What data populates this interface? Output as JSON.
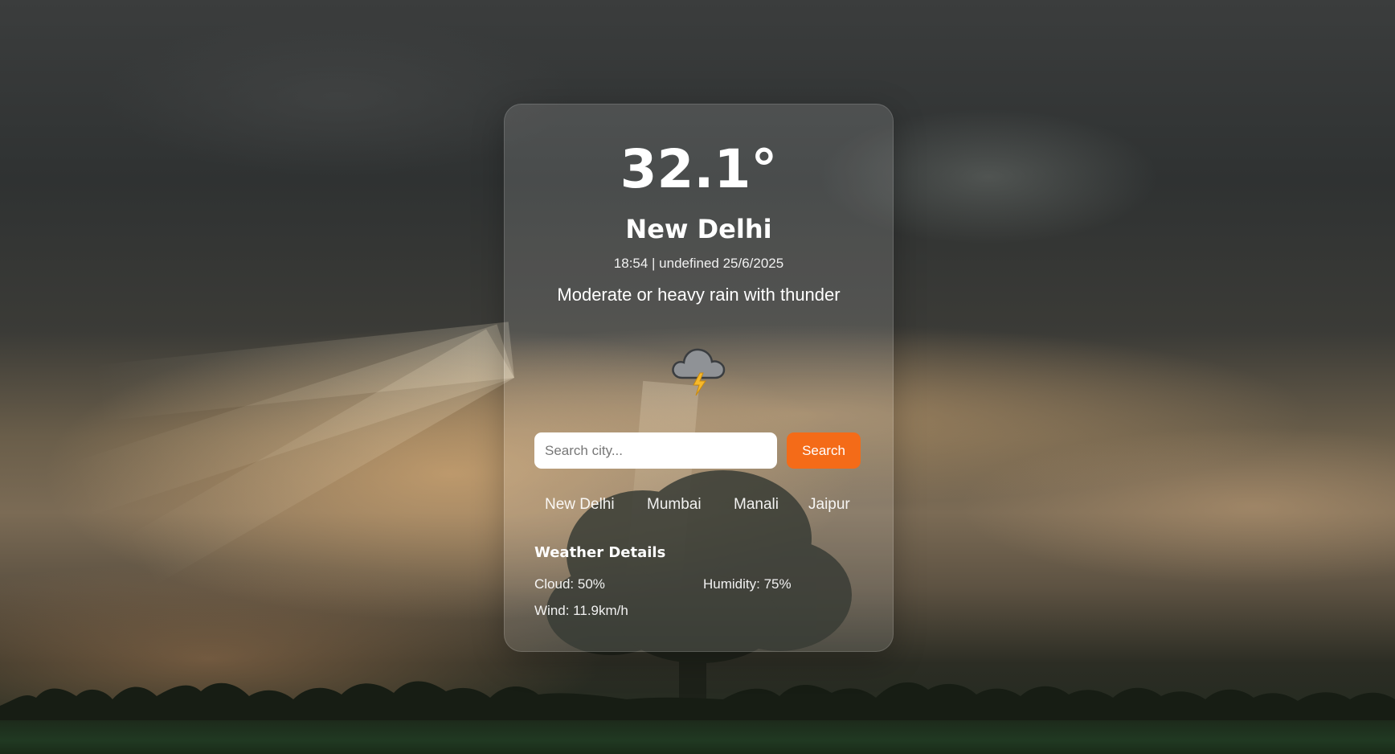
{
  "weather": {
    "temperature": "32.1°",
    "city": "New Delhi",
    "datetime": "18:54 | undefined 25/6/2025",
    "condition": "Moderate or heavy rain with thunder",
    "icon": "thunder-cloud-icon"
  },
  "search": {
    "placeholder": "Search city...",
    "value": "",
    "button_label": "Search",
    "button_color": "#f46b18"
  },
  "quick_cities": [
    "New Delhi",
    "Mumbai",
    "Manali",
    "Jaipur"
  ],
  "details": {
    "title": "Weather Details",
    "cloud": "Cloud: 50%",
    "humidity": "Humidity: 75%",
    "wind": "Wind: 11.9km/h"
  }
}
